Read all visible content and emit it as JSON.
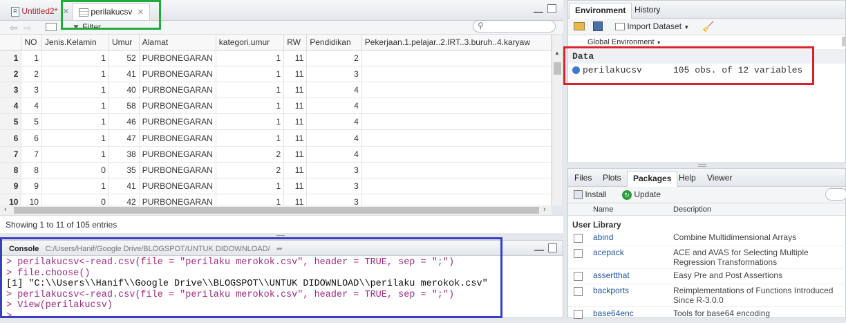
{
  "source_tabs": [
    {
      "label": "Untitled2*",
      "active": false
    },
    {
      "label": "perilakucsv",
      "active": true
    }
  ],
  "filter_label": "Filter",
  "grid": {
    "columns": [
      "",
      "NO",
      "Jenis.Kelamin",
      "Umur",
      "Alamat",
      "kategori.umur",
      "RW",
      "Pendidikan",
      "Pekerjaan.1.pelajar..2.IRT..3.buruh..4.karyaw"
    ],
    "rows": [
      [
        "1",
        "1",
        "1",
        "52",
        "PURBONEGARAN",
        "1",
        "11",
        "2",
        ""
      ],
      [
        "2",
        "2",
        "1",
        "41",
        "PURBONEGARAN",
        "1",
        "11",
        "3",
        ""
      ],
      [
        "3",
        "3",
        "1",
        "40",
        "PURBONEGARAN",
        "1",
        "11",
        "4",
        ""
      ],
      [
        "4",
        "4",
        "1",
        "58",
        "PURBONEGARAN",
        "1",
        "11",
        "4",
        ""
      ],
      [
        "5",
        "5",
        "1",
        "46",
        "PURBONEGARAN",
        "1",
        "11",
        "4",
        ""
      ],
      [
        "6",
        "6",
        "1",
        "47",
        "PURBONEGARAN",
        "1",
        "11",
        "4",
        ""
      ],
      [
        "7",
        "7",
        "1",
        "38",
        "PURBONEGARAN",
        "2",
        "11",
        "4",
        ""
      ],
      [
        "8",
        "8",
        "0",
        "35",
        "PURBONEGARAN",
        "2",
        "11",
        "3",
        ""
      ],
      [
        "9",
        "9",
        "1",
        "41",
        "PURBONEGARAN",
        "1",
        "11",
        "3",
        ""
      ],
      [
        "10",
        "10",
        "0",
        "42",
        "PURBONEGARAN",
        "1",
        "11",
        "3",
        ""
      ]
    ]
  },
  "status_text": "Showing 1 to 11 of 105 entries",
  "console": {
    "title": "Console",
    "path": "C:/Users/Hanif/Google Drive/BLOGSPOT/UNTUK DIDOWNLOAD/",
    "lines": [
      {
        "type": "cmd",
        "text": "> perilakucsv<-read.csv(file = \"perilaku merokok.csv\", header = TRUE, sep = \";\")"
      },
      {
        "type": "cmd",
        "text": "> file.choose()"
      },
      {
        "type": "out",
        "text": "[1] \"C:\\\\Users\\\\Hanif\\\\Google Drive\\\\BLOGSPOT\\\\UNTUK DIDOWNLOAD\\\\perilaku merokok.csv\""
      },
      {
        "type": "cmd",
        "text": "> perilakucsv<-read.csv(file = \"perilaku merokok.csv\", header = TRUE, sep = \";\")"
      },
      {
        "type": "cmd",
        "text": "> View(perilakucsv)"
      },
      {
        "type": "cmd",
        "text": ">"
      }
    ]
  },
  "env": {
    "tabs": [
      "Environment",
      "History"
    ],
    "import_label": "Import Dataset",
    "global_env_label": "Global Environment",
    "section": "Data",
    "object_name": "perilakucsv",
    "object_desc": "105 obs. of 12 variables"
  },
  "packages": {
    "tabs": [
      "Files",
      "Plots",
      "Packages",
      "Help",
      "Viewer"
    ],
    "install_label": "Install",
    "update_label": "Update",
    "col_name": "Name",
    "col_desc": "Description",
    "library_label": "User Library",
    "items": [
      {
        "name": "abind",
        "desc": "Combine Multidimensional Arrays"
      },
      {
        "name": "acepack",
        "desc": "ACE and AVAS for Selecting Multiple Regression Transformations"
      },
      {
        "name": "assertthat",
        "desc": "Easy Pre and Post Assertions"
      },
      {
        "name": "backports",
        "desc": "Reimplementations of Functions Introduced Since R-3.0.0"
      },
      {
        "name": "base64enc",
        "desc": "Tools for base64 encoding"
      }
    ]
  },
  "colors": {
    "highlight_green": "#22aa3a",
    "highlight_red": "#d8232a",
    "highlight_blue": "#3a3fbf",
    "console_cmd": "#9e2a83",
    "link_blue": "#1c56a3"
  }
}
